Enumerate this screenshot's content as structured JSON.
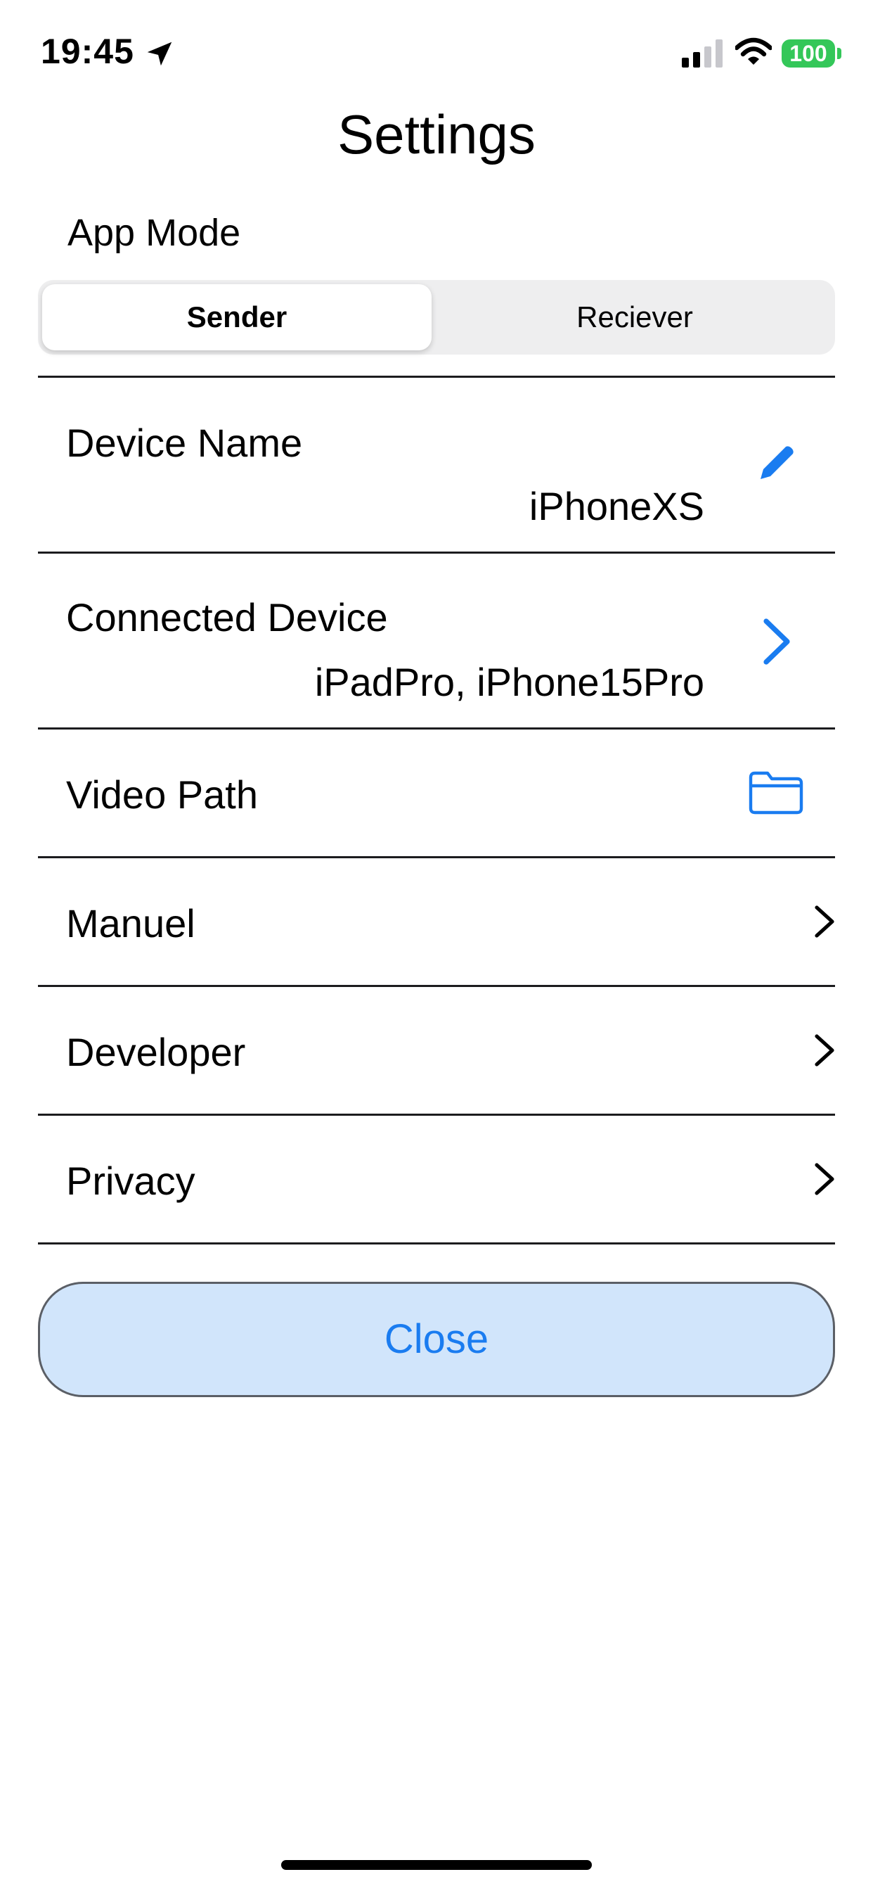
{
  "status_bar": {
    "time": "19:45",
    "battery": "100",
    "icons": [
      "location-arrow-icon",
      "cellular-signal-icon",
      "wifi-icon",
      "battery-icon"
    ]
  },
  "title": "Settings",
  "app_mode": {
    "label": "App Mode",
    "options": [
      "Sender",
      "Reciever"
    ],
    "selected": "Sender"
  },
  "rows": {
    "device_name": {
      "label": "Device Name",
      "value": "iPhoneXS",
      "icon": "pencil-icon"
    },
    "connected_device": {
      "label": "Connected Device",
      "value": "iPadPro, iPhone15Pro",
      "icon": "chevron-right-icon"
    },
    "video_path": {
      "label": "Video Path",
      "icon": "folder-icon"
    },
    "manuel": {
      "label": "Manuel",
      "icon": "chevron-right-icon"
    },
    "developer": {
      "label": "Developer",
      "icon": "chevron-right-icon"
    },
    "privacy": {
      "label": "Privacy",
      "icon": "chevron-right-icon"
    }
  },
  "close_button": {
    "label": "Close"
  },
  "colors": {
    "accent": "#1a7cf0",
    "button_fill": "#d1e5fb",
    "battery": "#34c759",
    "segment_track": "#eeeeef"
  }
}
